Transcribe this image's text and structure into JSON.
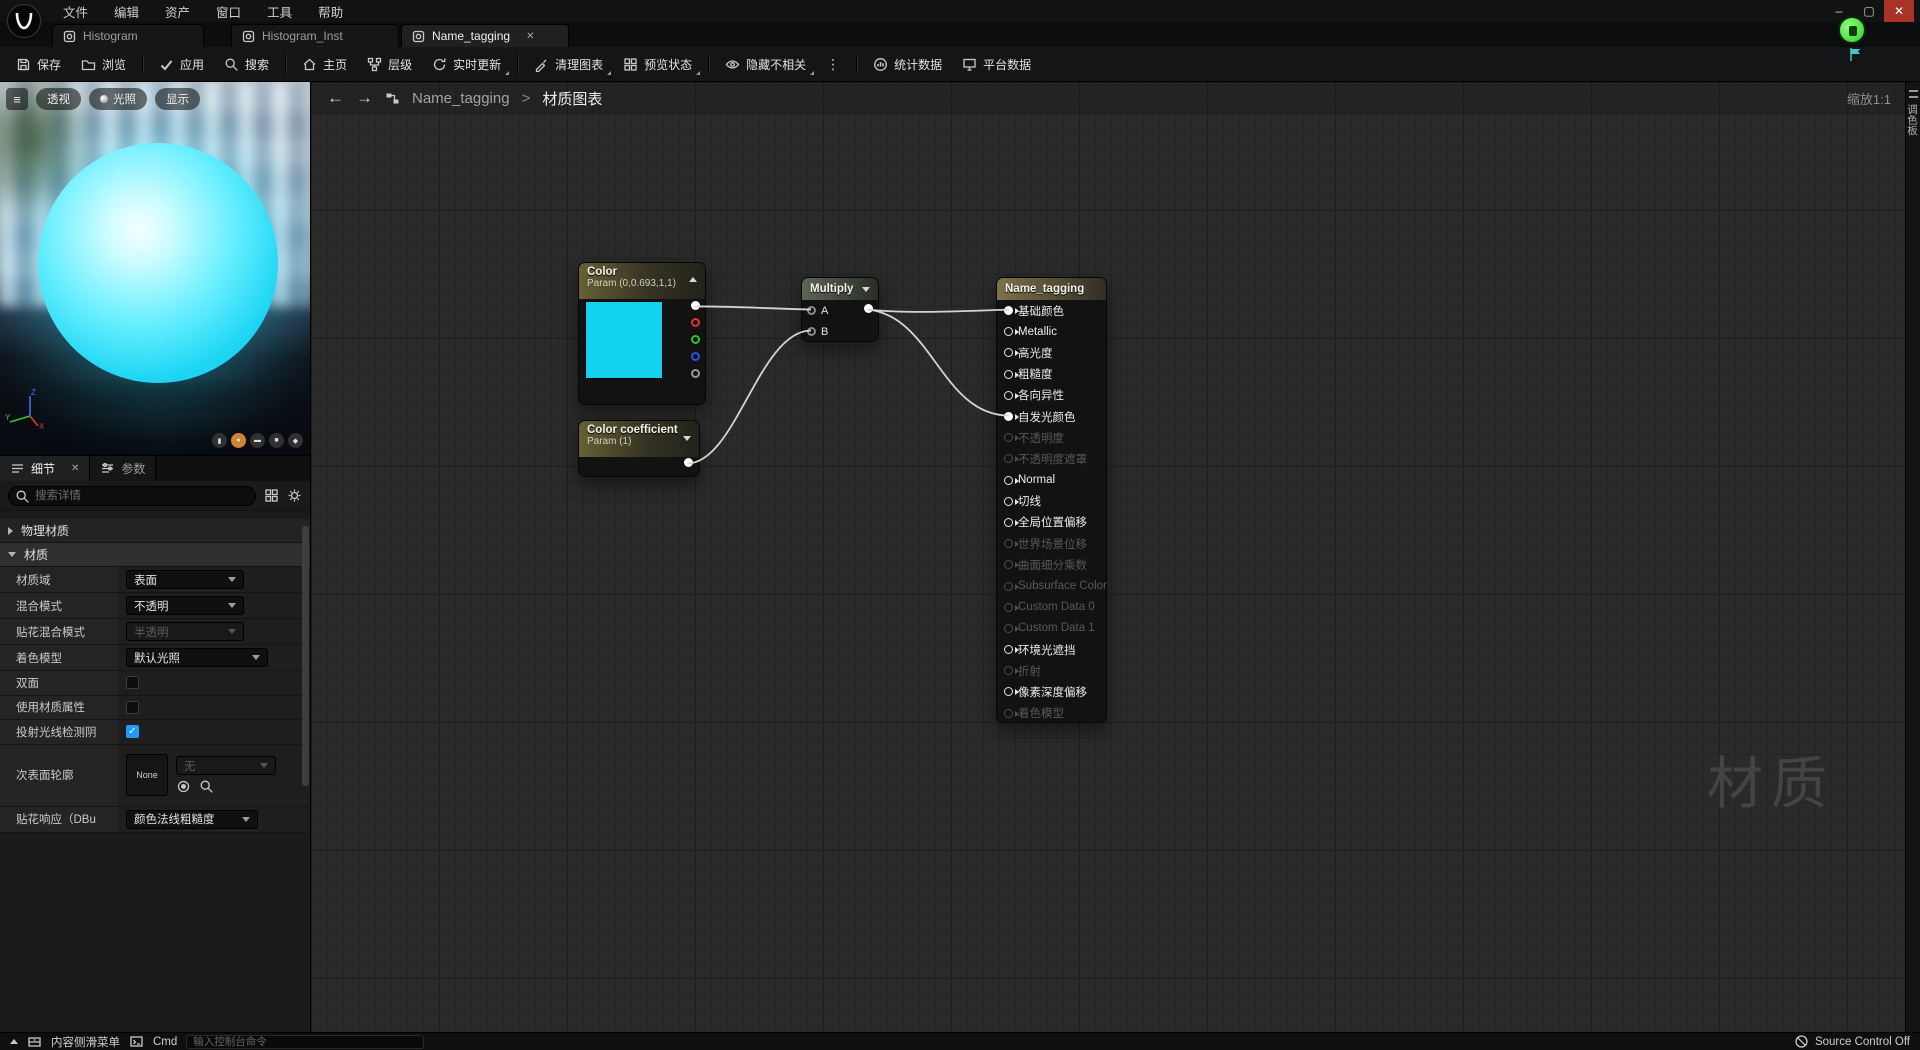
{
  "colors": {
    "param_cyan": "#12d2f0",
    "wire": "#d4d4d4",
    "checkbox_blue": "#1f9bff"
  },
  "menu": {
    "items": [
      {
        "label": "文件"
      },
      {
        "label": "编辑"
      },
      {
        "label": "资产"
      },
      {
        "label": "窗口"
      },
      {
        "label": "工具"
      },
      {
        "label": "帮助"
      }
    ]
  },
  "window_controls": {
    "minimize": "–",
    "maximize": "▢",
    "close": "✕"
  },
  "tab_bar": {
    "tab1": "Histogram",
    "tab2": "Histogram_Inst",
    "tab3": "Name_tagging",
    "close_glyph": "✕"
  },
  "toolbar": {
    "save": "保存",
    "browse": "浏览",
    "apply": "应用",
    "search": "搜索",
    "home": "主页",
    "hierarchy": "层级",
    "live_update": "实时更新",
    "clean_graph": "清理图表",
    "preview_state": "预览状态",
    "hide_unrelated": "隐藏不相关",
    "more": "⋮",
    "stats": "统计数据",
    "platform_stats": "平台数据"
  },
  "viewport": {
    "menu_glyph": "≡",
    "perspective": "透视",
    "lit": "光照",
    "show": "显示"
  },
  "details_panel": {
    "tab_details": "细节",
    "tab_params": "参数",
    "close_glyph": "✕",
    "search_placeholder": "搜索详情",
    "section_physical": "物理材质",
    "section_material": "材质",
    "rows": {
      "domain": {
        "label": "材质域",
        "value": "表面"
      },
      "blend": {
        "label": "混合模式",
        "value": "不透明"
      },
      "decal_blend": {
        "label": "贴花混合模式",
        "value": "半透明"
      },
      "shading": {
        "label": "着色模型",
        "value": "默认光照"
      },
      "two_sided": {
        "label": "双面"
      },
      "use_attrs": {
        "label": "使用材质属性"
      },
      "cast_ray": {
        "label": "投射光线检测阴",
        "checked": true,
        "check": "✓"
      },
      "subsurface": {
        "label": "次表面轮廓",
        "thumb": "None",
        "value": "无"
      },
      "decal_response": {
        "label": "贴花响应（DBu",
        "value": "颜色法线粗糙度"
      }
    }
  },
  "graph": {
    "breadcrumb": {
      "asset": "Name_tagging",
      "sep": ">",
      "page": "材质图表"
    },
    "zoom": "缩放1:1",
    "watermark": "材质",
    "palette_tab": "调色板",
    "nodes": {
      "color": {
        "title": "Color",
        "subtitle": "Param (0,0.693,1,1)",
        "outputs": [
          {
            "state": "p-white"
          },
          {
            "state": "p-r"
          },
          {
            "state": "p-g"
          },
          {
            "state": "p-b"
          },
          {
            "state": "p-a"
          }
        ]
      },
      "coefficient": {
        "title": "Color coefficient",
        "subtitle": "Param (1)"
      },
      "multiply": {
        "title": "Multiply",
        "inputs": [
          {
            "label": "A"
          },
          {
            "label": "B"
          }
        ]
      },
      "result": {
        "title": "Name_tagging",
        "pins": [
          {
            "label": "基础颜色",
            "state": "connected"
          },
          {
            "label": "Metallic",
            "state": "enabled"
          },
          {
            "label": "高光度",
            "state": "enabled"
          },
          {
            "label": "粗糙度",
            "state": "enabled"
          },
          {
            "label": "各向异性",
            "state": "enabled"
          },
          {
            "label": "自发光颜色",
            "state": "connected"
          },
          {
            "label": "不透明度",
            "state": "disabled"
          },
          {
            "label": "不透明度遮罩",
            "state": "disabled"
          },
          {
            "label": "Normal",
            "state": "enabled"
          },
          {
            "label": "切线",
            "state": "enabled"
          },
          {
            "label": "全局位置偏移",
            "state": "enabled"
          },
          {
            "label": "世界场景位移",
            "state": "disabled"
          },
          {
            "label": "曲面细分乘数",
            "state": "disabled"
          },
          {
            "label": "Subsurface Color",
            "state": "disabled"
          },
          {
            "label": "Custom Data 0",
            "state": "disabled"
          },
          {
            "label": "Custom Data 1",
            "state": "disabled"
          },
          {
            "label": "环境光遮挡",
            "state": "enabled"
          },
          {
            "label": "折射",
            "state": "disabled"
          },
          {
            "label": "像素深度偏移",
            "state": "enabled"
          },
          {
            "label": "着色模型",
            "state": "disabled"
          }
        ]
      }
    }
  },
  "bottom_bar": {
    "content_drawer": "内容侧滑菜单",
    "cmd": "Cmd",
    "console_placeholder": "输入控制台命令",
    "source_control": "Source Control Off"
  }
}
